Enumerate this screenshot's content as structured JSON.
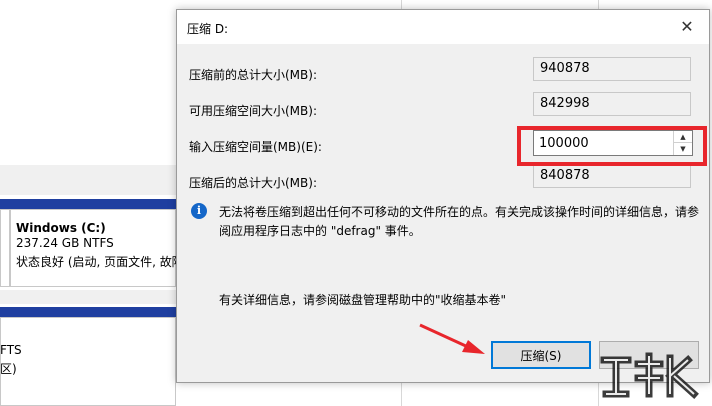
{
  "dialog": {
    "title": "压缩 D:",
    "close_glyph": "✕",
    "rows": [
      {
        "label": "压缩前的总计大小(MB):",
        "value": "940878"
      },
      {
        "label": "可用压缩空间大小(MB):",
        "value": "842998"
      },
      {
        "label": "输入压缩空间量(MB)(E):",
        "value": "100000"
      },
      {
        "label": "压缩后的总计大小(MB):",
        "value": "840878"
      }
    ],
    "info_icon_glyph": "i",
    "info_text": "无法将卷压缩到超出任何不可移动的文件所在的点。有关完成该操作时间的详细信息，请参阅应用程序日志中的 \"defrag\" 事件。",
    "help_text": "有关详细信息，请参阅磁盘管理帮助中的\"收缩基本卷\"",
    "shrink_button": "压缩(S)"
  },
  "background": {
    "volume_name": "Windows  (C:)",
    "volume_size": "237.24 GB NTFS",
    "volume_status": "状态良好 (启动, 页面文件, 故障",
    "disk2_fs": "FTS",
    "disk2_status": "区)"
  },
  "colors": {
    "highlight": "#e8262c",
    "primary_border": "#0078d7",
    "disk_band": "#1f3fa0",
    "info_icon": "#1466c8"
  },
  "icons": [
    "close-icon",
    "info-icon",
    "spin-up-icon",
    "spin-down-icon",
    "arrow-annotation",
    "watermark-logo"
  ]
}
